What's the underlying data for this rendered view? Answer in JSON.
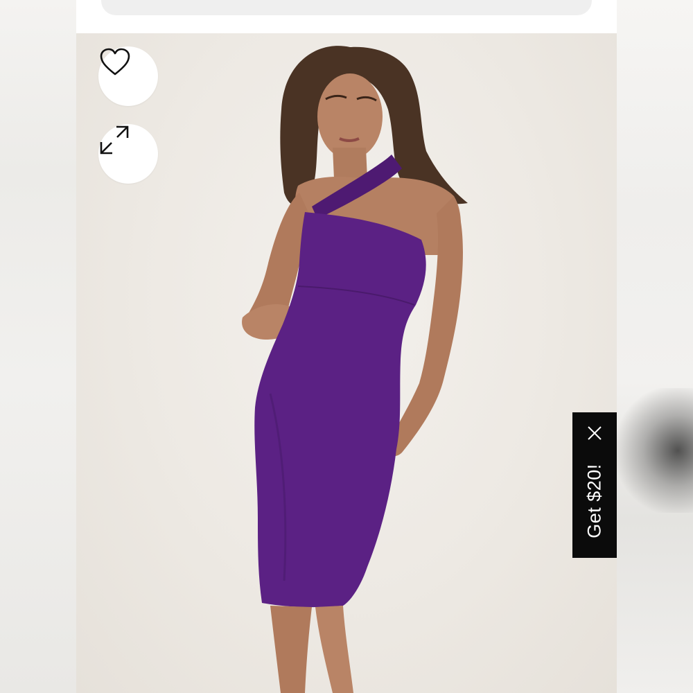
{
  "product_image": {
    "description_icon": "model-photo",
    "dress_color": "#5b2184"
  },
  "actions": {
    "favorite_icon": "heart-icon",
    "expand_icon": "expand-icon"
  },
  "promo": {
    "label": "Get $20!",
    "close_icon": "close-icon"
  }
}
